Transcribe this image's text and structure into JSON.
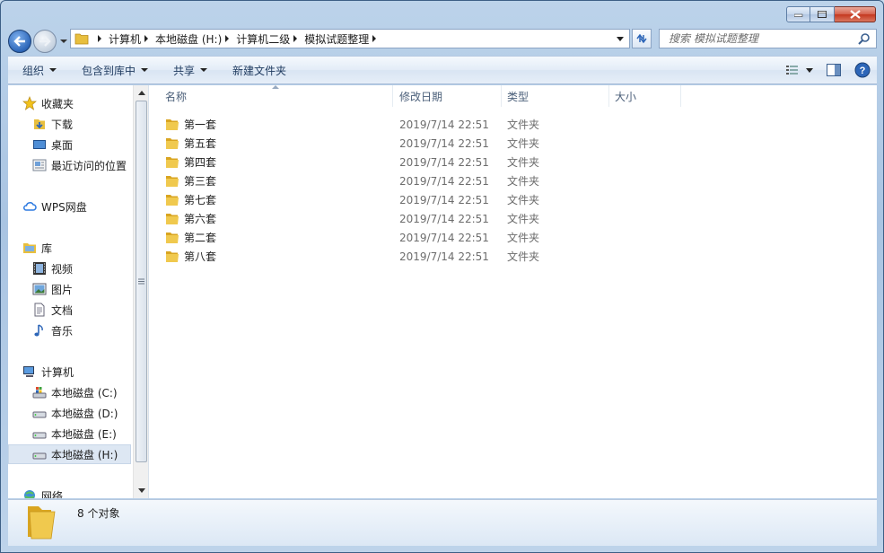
{
  "address": {
    "crumbs": [
      "计算机",
      "本地磁盘 (H:)",
      "计算机二级",
      "模拟试题整理"
    ]
  },
  "search": {
    "placeholder": "搜索 模拟试题整理"
  },
  "toolbar": {
    "organize": "组织",
    "include_in_library": "包含到库中",
    "share": "共享",
    "new_folder": "新建文件夹"
  },
  "nav": {
    "favorites": "收藏夹",
    "downloads": "下载",
    "desktop": "桌面",
    "recent": "最近访问的位置",
    "wps_cloud": "WPS网盘",
    "libraries": "库",
    "videos": "视频",
    "pictures": "图片",
    "documents": "文档",
    "music": "音乐",
    "computer": "计算机",
    "drive_c": "本地磁盘 (C:)",
    "drive_d": "本地磁盘 (D:)",
    "drive_e": "本地磁盘 (E:)",
    "drive_h": "本地磁盘 (H:)",
    "network": "网络"
  },
  "columns": {
    "name": "名称",
    "date": "修改日期",
    "type": "类型",
    "size": "大小"
  },
  "files": [
    {
      "name": "第一套",
      "date": "2019/7/14 22:51",
      "type": "文件夹"
    },
    {
      "name": "第五套",
      "date": "2019/7/14 22:51",
      "type": "文件夹"
    },
    {
      "name": "第四套",
      "date": "2019/7/14 22:51",
      "type": "文件夹"
    },
    {
      "name": "第三套",
      "date": "2019/7/14 22:51",
      "type": "文件夹"
    },
    {
      "name": "第七套",
      "date": "2019/7/14 22:51",
      "type": "文件夹"
    },
    {
      "name": "第六套",
      "date": "2019/7/14 22:51",
      "type": "文件夹"
    },
    {
      "name": "第二套",
      "date": "2019/7/14 22:51",
      "type": "文件夹"
    },
    {
      "name": "第八套",
      "date": "2019/7/14 22:51",
      "type": "文件夹"
    }
  ],
  "status": {
    "count": "8 个对象"
  },
  "icons": {
    "folder": "folder-icon",
    "back": "back-arrow-icon",
    "forward": "forward-arrow-icon",
    "refresh": "refresh-icon",
    "search": "search-icon",
    "help": "help-icon"
  },
  "colors": {
    "folder": "#e8bf3e",
    "accent": "#2d66b8",
    "selection": "#dde7f3"
  }
}
